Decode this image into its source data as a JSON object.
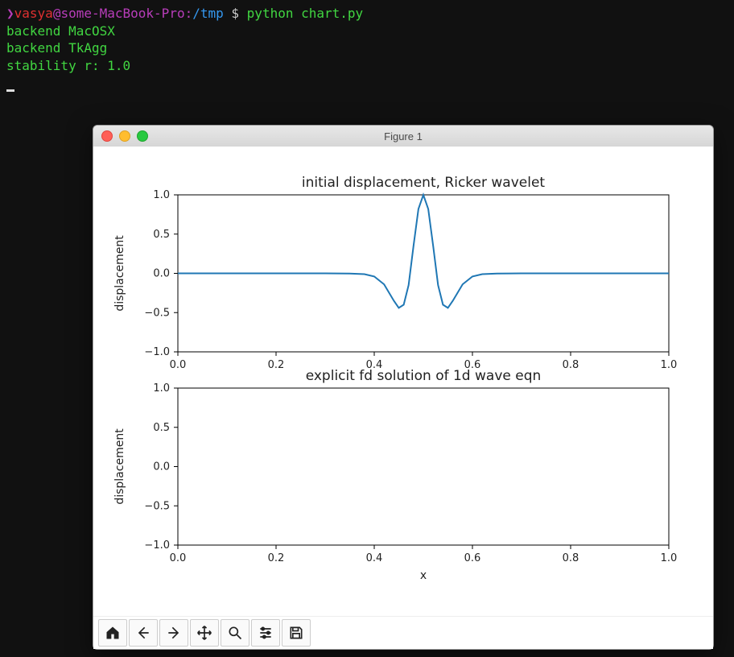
{
  "terminal": {
    "prompt": {
      "caret": "❯",
      "user": "vasya",
      "at": "@",
      "host": "some-MacBook-Pro",
      "sep": ":",
      "path": "/tmp",
      "dollar": "$",
      "command": "python chart.py"
    },
    "output": [
      "backend MacOSX",
      "backend TkAgg",
      "stability r: 1.0"
    ]
  },
  "window": {
    "title": "Figure 1"
  },
  "toolbar_icons": [
    "home",
    "back",
    "forward",
    "pan",
    "zoom",
    "configure",
    "save"
  ],
  "chart_data": [
    {
      "type": "line",
      "title": "initial displacement, Ricker wavelet",
      "xlabel": "",
      "ylabel": "displacement",
      "xlim": [
        0.0,
        1.0
      ],
      "ylim": [
        -1.0,
        1.0
      ],
      "xticks": [
        0.0,
        0.2,
        0.4,
        0.6,
        0.8,
        1.0
      ],
      "yticks": [
        -1.0,
        -0.5,
        0.0,
        0.5,
        1.0
      ],
      "series": [
        {
          "name": "ricker",
          "x": [
            0.0,
            0.05,
            0.1,
            0.15,
            0.2,
            0.25,
            0.3,
            0.35,
            0.38,
            0.4,
            0.42,
            0.44,
            0.45,
            0.46,
            0.47,
            0.48,
            0.49,
            0.5,
            0.51,
            0.52,
            0.53,
            0.54,
            0.55,
            0.56,
            0.58,
            0.6,
            0.62,
            0.65,
            0.7,
            0.75,
            0.8,
            0.85,
            0.9,
            0.95,
            1.0
          ],
          "y": [
            0.0,
            0.0,
            0.0,
            0.0,
            0.0,
            0.0,
            0.0,
            -0.002,
            -0.01,
            -0.04,
            -0.14,
            -0.35,
            -0.44,
            -0.4,
            -0.15,
            0.35,
            0.82,
            1.0,
            0.82,
            0.35,
            -0.15,
            -0.4,
            -0.44,
            -0.35,
            -0.14,
            -0.04,
            -0.01,
            -0.002,
            0.0,
            0.0,
            0.0,
            0.0,
            0.0,
            0.0,
            0.0
          ]
        }
      ]
    },
    {
      "type": "line",
      "title": "explicit fd solution of 1d wave eqn",
      "xlabel": "x",
      "ylabel": "displacement",
      "xlim": [
        0.0,
        1.0
      ],
      "ylim": [
        -1.0,
        1.0
      ],
      "xticks": [
        0.0,
        0.2,
        0.4,
        0.6,
        0.8,
        1.0
      ],
      "yticks": [
        -1.0,
        -0.5,
        0.0,
        0.5,
        1.0
      ],
      "series": []
    }
  ]
}
